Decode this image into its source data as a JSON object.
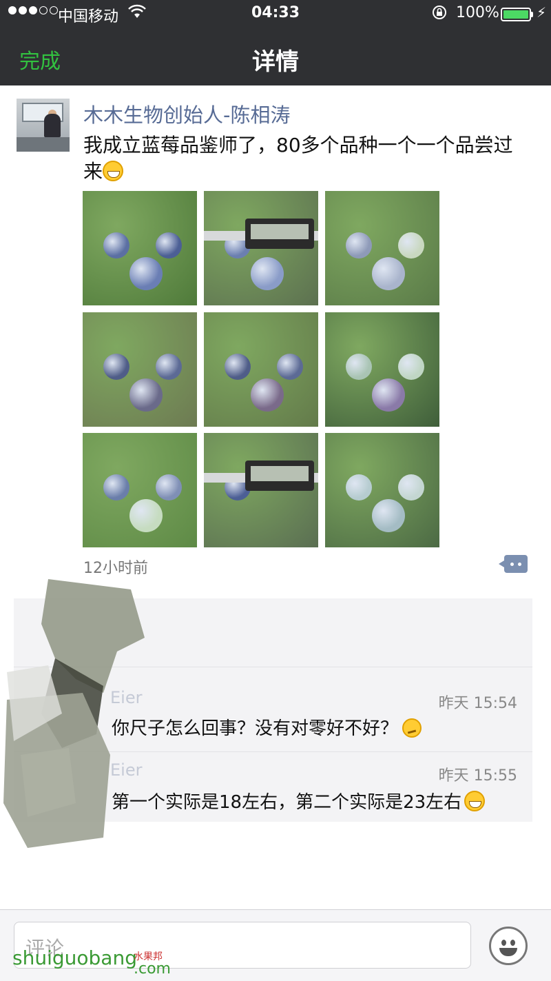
{
  "status_bar": {
    "carrier": "中国移动",
    "time": "04:33",
    "battery": "100%",
    "battery_level": 1.0
  },
  "nav": {
    "back_label": "完成",
    "title": "详情"
  },
  "post": {
    "author": "木木生物创始人-陈相涛",
    "text": "我成立蓝莓品鉴师了，80多个品种一个一个品尝过来",
    "time_ago": "12小时前",
    "photos": [
      "blueberry-photo-1",
      "caliper-photo-1",
      "blueberry-photo-2",
      "blueberry-photo-3",
      "blueberry-photo-4",
      "blueberry-photo-5",
      "blueberry-photo-6",
      "caliper-photo-2",
      "blueberry-photo-7"
    ]
  },
  "comments": [
    {
      "name": "Eier",
      "time": "昨天 15:54",
      "text": "你尺子怎么回事？没有对零好不好？"
    },
    {
      "name": "Eier",
      "time": "昨天 15:55",
      "text": "第一个实际是18左右，第二个实际是23左右"
    }
  ],
  "composer": {
    "placeholder": "评论"
  },
  "watermark": {
    "site": "shuiguobang",
    "cn": "水果邦",
    "tld": ".com"
  },
  "colors": {
    "nav_bg": "#2f3033",
    "accent_green": "#32c240",
    "author_blue": "#576b95"
  }
}
